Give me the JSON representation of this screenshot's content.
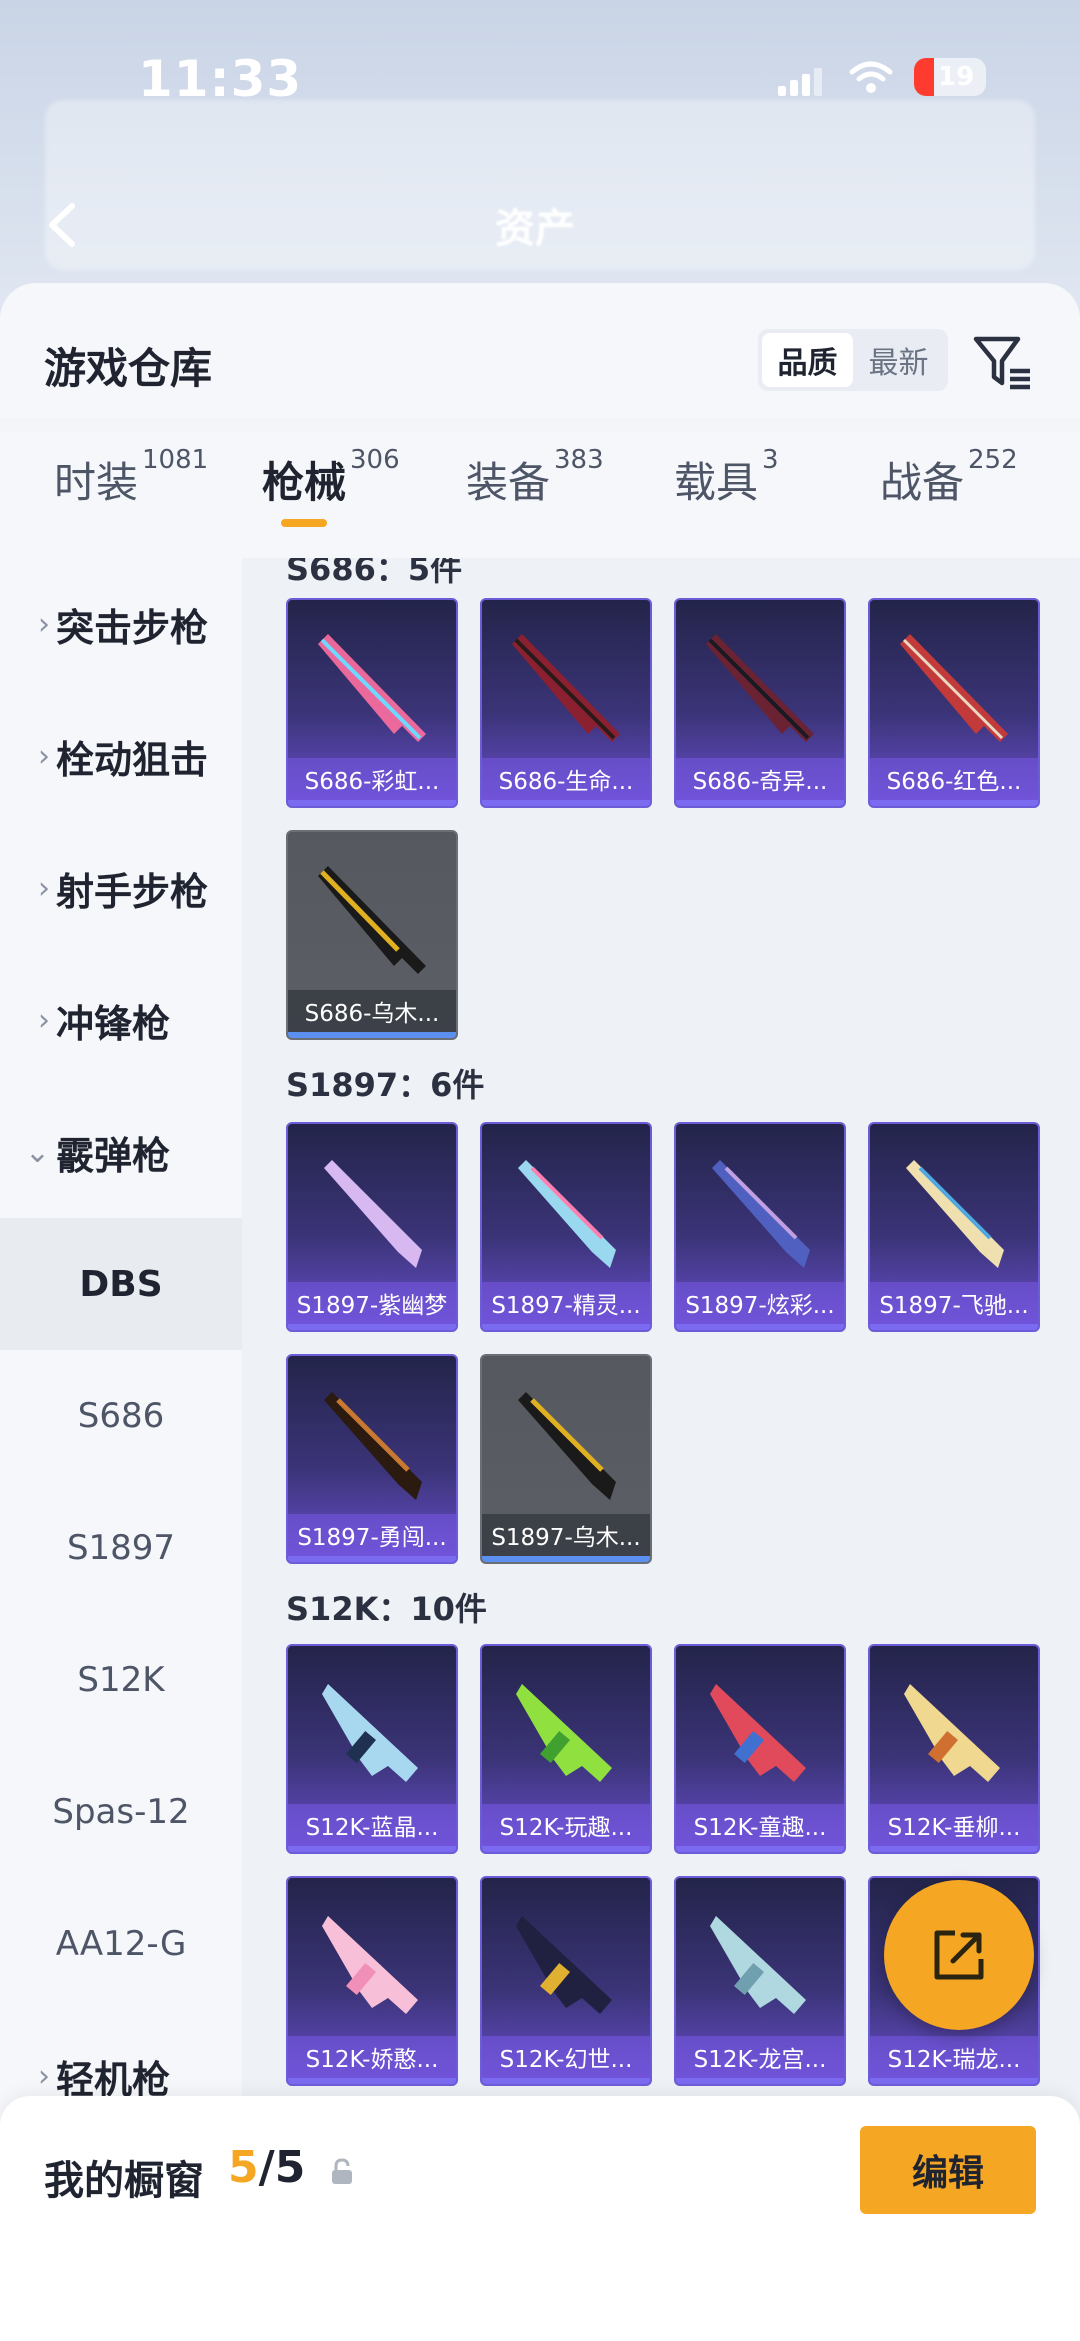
{
  "status_bar": {
    "time": "11:33",
    "battery": "19"
  },
  "header": {
    "title": "资产"
  },
  "sheet": {
    "title": "游戏仓库"
  },
  "sort": {
    "options": [
      "品质",
      "最新"
    ],
    "active": "品质"
  },
  "tabs": [
    {
      "label": "时装",
      "count": "1081"
    },
    {
      "label": "枪械",
      "count": "306",
      "active": true
    },
    {
      "label": "装备",
      "count": "383"
    },
    {
      "label": "载具",
      "count": "3"
    },
    {
      "label": "战备",
      "count": "252"
    }
  ],
  "sidebar": {
    "categories": [
      {
        "label": "突击步枪",
        "expanded": false
      },
      {
        "label": "栓动狙击",
        "expanded": false
      },
      {
        "label": "射手步枪",
        "expanded": false
      },
      {
        "label": "冲锋枪",
        "expanded": false
      },
      {
        "label": "霰弹枪",
        "expanded": true
      }
    ],
    "subitems": [
      "DBS",
      "S686",
      "S1897",
      "S12K",
      "Spas-12",
      "AA12-G"
    ],
    "active_subitem": "DBS",
    "last_category": {
      "label": "轻机枪",
      "expanded": false
    }
  },
  "groups": [
    {
      "title": "S686：5件",
      "items": [
        "S686-彩虹...",
        "S686-生命...",
        "S686-奇异...",
        "S686-红色...",
        "S686-乌木..."
      ]
    },
    {
      "title": "S1897：6件",
      "items": [
        "S1897-紫幽梦",
        "S1897-精灵...",
        "S1897-炫彩...",
        "S1897-飞驰...",
        "S1897-勇闯...",
        "S1897-乌木..."
      ]
    },
    {
      "title": "S12K：10件",
      "items": [
        "S12K-蓝晶...",
        "S12K-玩趣...",
        "S12K-童趣...",
        "S12K-垂柳...",
        "S12K-娇憨...",
        "S12K-幻世...",
        "S12K-龙宫...",
        "S12K-瑞龙..."
      ]
    }
  ],
  "showcase": {
    "label": "我的橱窗",
    "current": "5",
    "total": "/5",
    "edit_label": "编辑"
  },
  "colors": {
    "accent": "#f5a623",
    "card_purple": "#3b3478"
  },
  "icons": [
    "back-icon",
    "filter-icon",
    "share-icon",
    "lock-icon",
    "chevron-right-icon",
    "chevron-down-icon"
  ]
}
